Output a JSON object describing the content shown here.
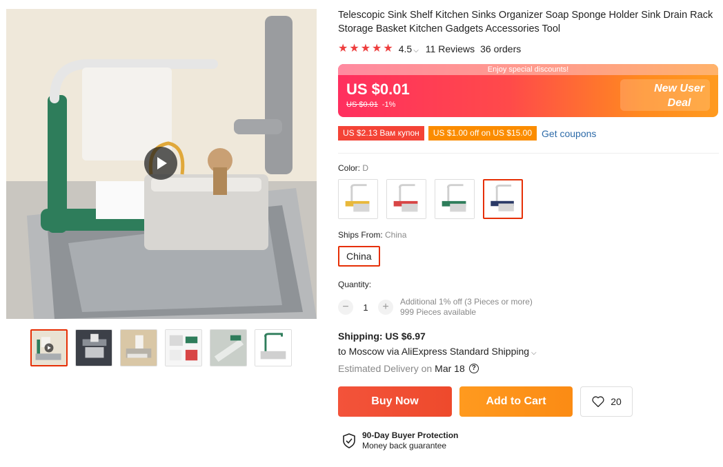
{
  "product": {
    "title": "Telescopic Sink Shelf Kitchen Sinks Organizer Soap Sponge Holder Sink Drain Rack Storage Basket Kitchen Gadgets Accessories Tool",
    "rating": "4.5",
    "rating_chevron": "⌵",
    "reviews": "11 Reviews",
    "orders": "36 orders",
    "stars": [
      "★",
      "★",
      "★",
      "★",
      "★"
    ]
  },
  "price_banner": {
    "strip_text": "Enjoy special discounts!",
    "price": "US $0.01",
    "old_price": "US $0.01",
    "discount": "-1%",
    "new_user_line1": "New User",
    "new_user_line2": "Deal"
  },
  "coupons": {
    "coupon1": "US $2.13 Вам купон",
    "coupon2": "US $1.00 off on US $15.00",
    "get_coupons": "Get coupons"
  },
  "color": {
    "label": "Color: ",
    "value": "D",
    "options": [
      {
        "name": "A",
        "accent": "#e8b83a"
      },
      {
        "name": "B",
        "accent": "#d84545"
      },
      {
        "name": "C",
        "accent": "#2e7d5b"
      },
      {
        "name": "D",
        "accent": "#2b3a67"
      }
    ]
  },
  "ships_from": {
    "label": "Ships From: ",
    "value": "China",
    "option": "China"
  },
  "quantity": {
    "label": "Quantity:",
    "minus": "−",
    "value": "1",
    "plus": "+",
    "discount_note": "Additional 1% off (3 Pieces or more)",
    "available": "999 Pieces available"
  },
  "shipping": {
    "title": "Shipping: US $6.97",
    "destination": "to Moscow via AliExpress Standard Shipping",
    "chevron": "⌵",
    "delivery_label": "Estimated Delivery on",
    "delivery_date": "Mar 18",
    "help": "?"
  },
  "actions": {
    "buy_now": "Buy Now",
    "add_to_cart": "Add to Cart",
    "wishlist_count": "20"
  },
  "protection": {
    "title": "90-Day Buyer Protection",
    "subtitle": "Money back guarantee"
  },
  "colors": {
    "accent_red": "#e62e04",
    "link_blue": "#2c6aa8",
    "organizer_green": "#2e7d5b"
  }
}
